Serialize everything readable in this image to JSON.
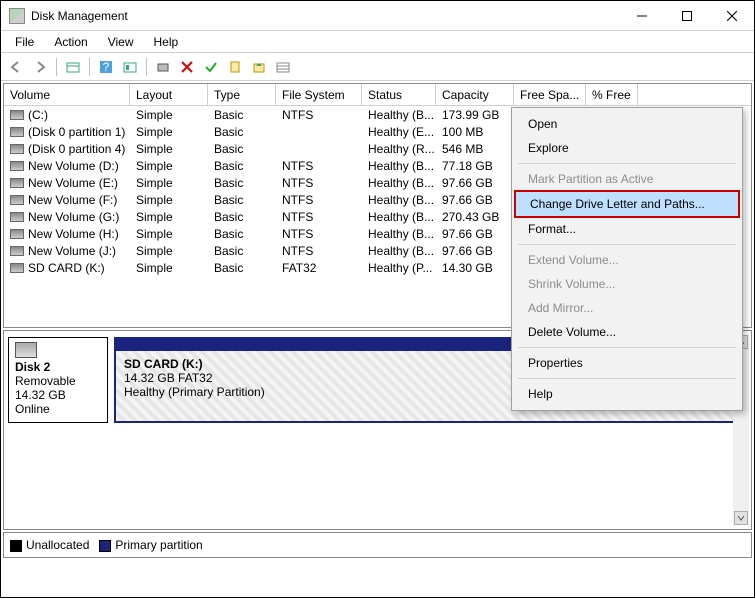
{
  "window": {
    "title": "Disk Management"
  },
  "menubar": [
    "File",
    "Action",
    "View",
    "Help"
  ],
  "columns": [
    "Volume",
    "Layout",
    "Type",
    "File System",
    "Status",
    "Capacity",
    "Free Spa...",
    "% Free"
  ],
  "volumes": [
    {
      "name": "(C:)",
      "layout": "Simple",
      "type": "Basic",
      "fs": "NTFS",
      "status": "Healthy (B...",
      "capacity": "173.99 GB"
    },
    {
      "name": "(Disk 0 partition 1)",
      "layout": "Simple",
      "type": "Basic",
      "fs": "",
      "status": "Healthy (E...",
      "capacity": "100 MB"
    },
    {
      "name": "(Disk 0 partition 4)",
      "layout": "Simple",
      "type": "Basic",
      "fs": "",
      "status": "Healthy (R...",
      "capacity": "546 MB"
    },
    {
      "name": "New Volume (D:)",
      "layout": "Simple",
      "type": "Basic",
      "fs": "NTFS",
      "status": "Healthy (B...",
      "capacity": "77.18 GB"
    },
    {
      "name": "New Volume (E:)",
      "layout": "Simple",
      "type": "Basic",
      "fs": "NTFS",
      "status": "Healthy (B...",
      "capacity": "97.66 GB"
    },
    {
      "name": "New Volume (F:)",
      "layout": "Simple",
      "type": "Basic",
      "fs": "NTFS",
      "status": "Healthy (B...",
      "capacity": "97.66 GB"
    },
    {
      "name": "New Volume (G:)",
      "layout": "Simple",
      "type": "Basic",
      "fs": "NTFS",
      "status": "Healthy (B...",
      "capacity": "270.43 GB"
    },
    {
      "name": "New Volume (H:)",
      "layout": "Simple",
      "type": "Basic",
      "fs": "NTFS",
      "status": "Healthy (B...",
      "capacity": "97.66 GB"
    },
    {
      "name": "New Volume (J:)",
      "layout": "Simple",
      "type": "Basic",
      "fs": "NTFS",
      "status": "Healthy (B...",
      "capacity": "97.66 GB"
    },
    {
      "name": "SD CARD (K:)",
      "layout": "Simple",
      "type": "Basic",
      "fs": "FAT32",
      "status": "Healthy (P...",
      "capacity": "14.30 GB"
    }
  ],
  "disk": {
    "name": "Disk 2",
    "kind": "Removable",
    "size": "14.32 GB",
    "state": "Online",
    "partition": {
      "title": "SD CARD  (K:)",
      "line2": "14.32 GB FAT32",
      "line3": "Healthy (Primary Partition)"
    }
  },
  "legend": {
    "unalloc": "Unallocated",
    "primary": "Primary partition"
  },
  "context_menu": {
    "open": "Open",
    "explore": "Explore",
    "mark": "Mark Partition as Active",
    "change": "Change Drive Letter and Paths...",
    "format": "Format...",
    "extend": "Extend Volume...",
    "shrink": "Shrink Volume...",
    "mirror": "Add Mirror...",
    "delete": "Delete Volume...",
    "properties": "Properties",
    "help": "Help"
  }
}
